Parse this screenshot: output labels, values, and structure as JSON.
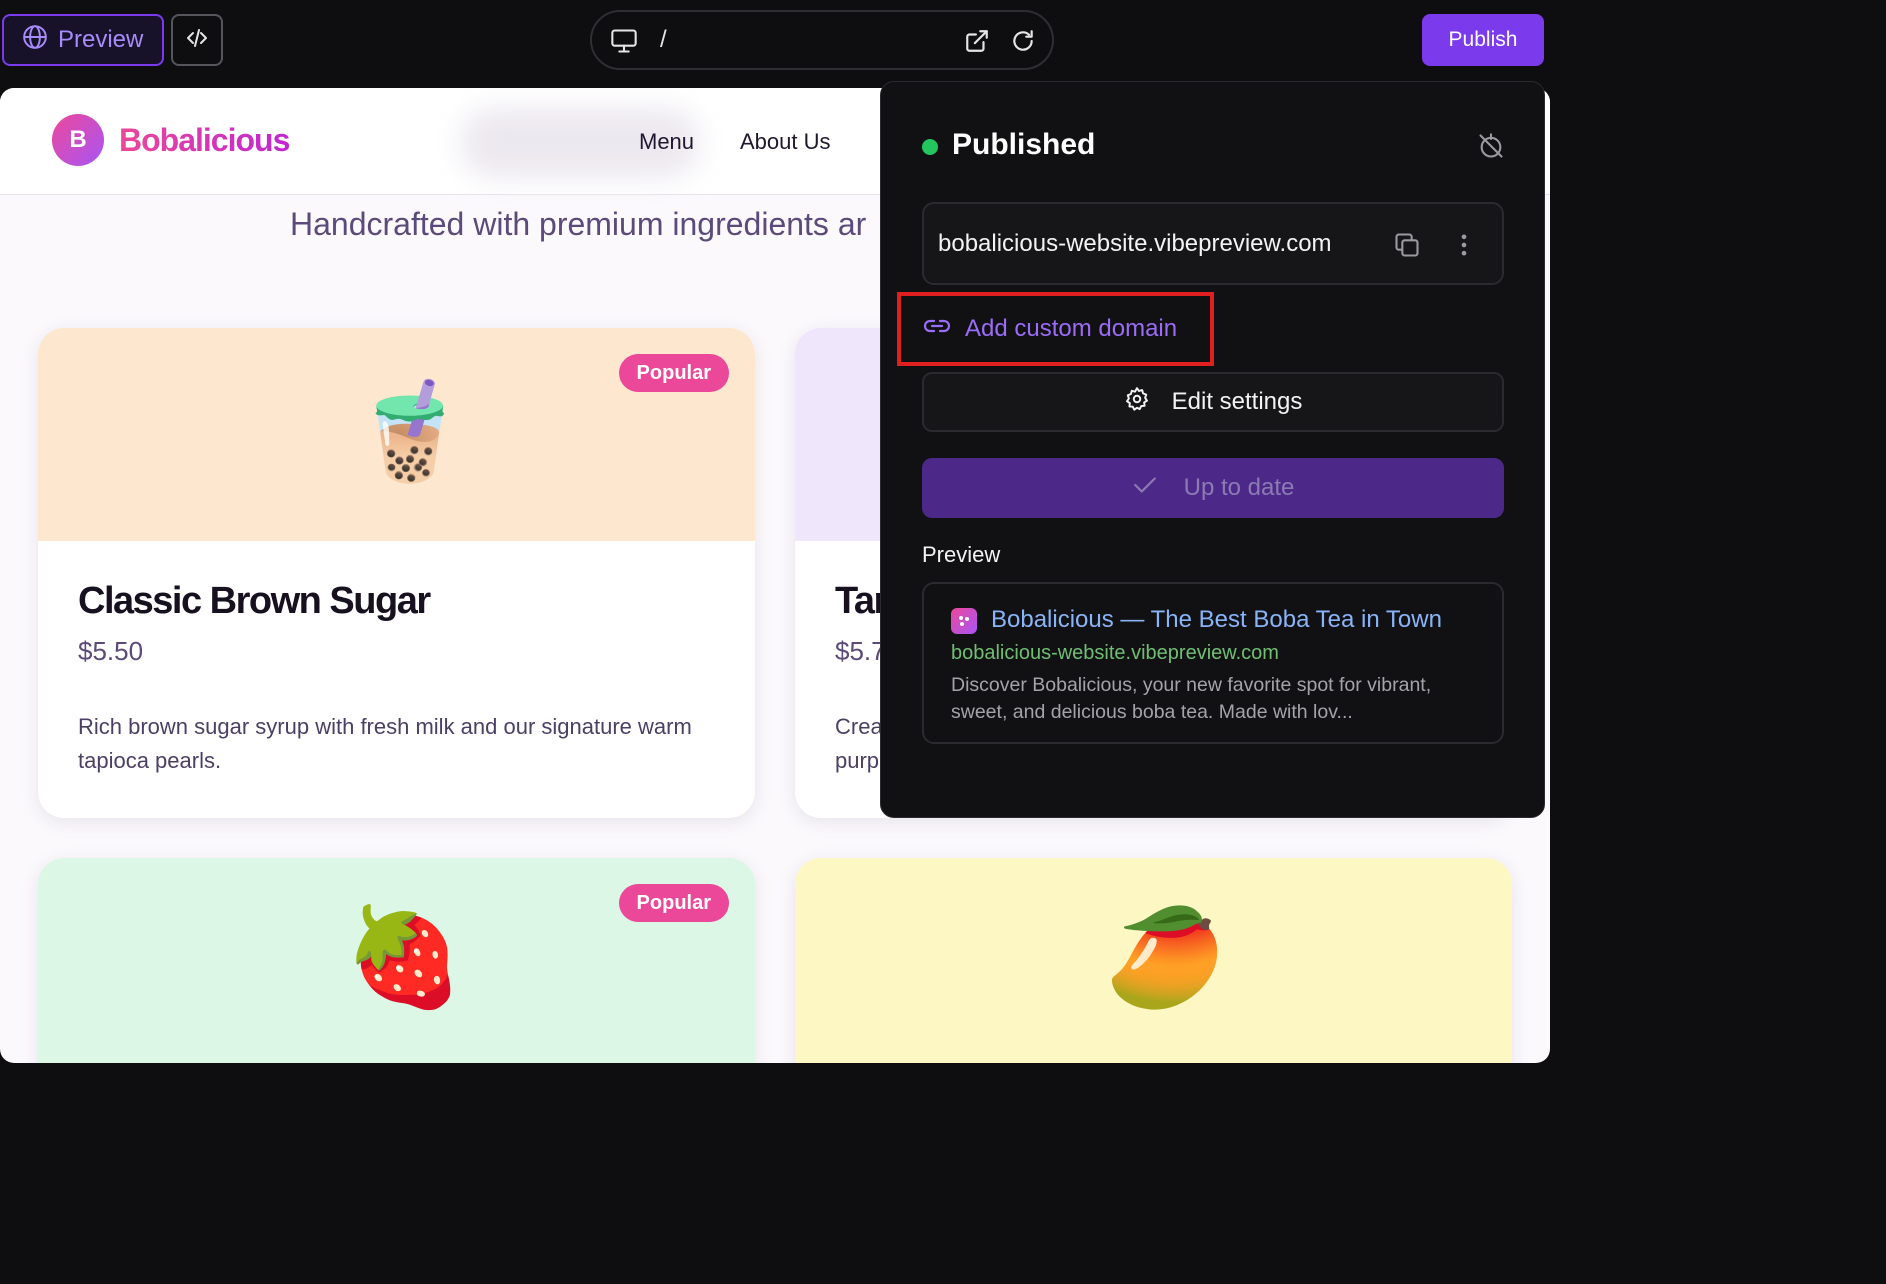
{
  "toolbar": {
    "preview_label": "Preview",
    "path": "/",
    "publish_label": "Publish"
  },
  "site": {
    "logo_letter": "B",
    "brand": "Bobalicious",
    "nav": [
      "Menu",
      "About Us"
    ],
    "tagline": "Handcrafted with premium ingredients ar",
    "cards": [
      {
        "title": "Classic Brown Sugar",
        "price": "$5.50",
        "description": "Rich brown sugar syrup with fresh milk and our signature warm tapioca pearls.",
        "badge": "Popular",
        "emoji": "🧋",
        "bg": "#fde8cf"
      },
      {
        "title": "Tar",
        "price": "$5.7",
        "description": "Crea purp",
        "badge": "",
        "emoji": "",
        "bg": "#efe6fb"
      },
      {
        "title": "",
        "price": "",
        "description": "",
        "badge": "Popular",
        "emoji": "🍓",
        "bg": "#dcf7e6"
      },
      {
        "title": "",
        "price": "",
        "description": "",
        "badge": "",
        "emoji": "🥭",
        "bg": "#fdf7c3"
      }
    ]
  },
  "popover": {
    "status": "Published",
    "status_color": "#22c55e",
    "domain": "bobalicious-website.vibepreview.com",
    "add_custom_domain": "Add custom domain",
    "edit_settings": "Edit settings",
    "up_to_date": "Up to date",
    "preview_heading": "Preview",
    "preview": {
      "title": "Bobalicious — The Best Boba Tea in Town",
      "url": "bobalicious-website.vibepreview.com",
      "description": "Discover Bobalicious, your new favorite spot for vibrant, sweet, and delicious boba tea. Made with lov..."
    }
  },
  "colors": {
    "accent": "#7c3aed",
    "brand_pink": "#ec4899",
    "highlight_box": "#e02020"
  },
  "icons": [
    "globe-icon",
    "code-icon",
    "monitor-icon",
    "external-link-icon",
    "reload-icon",
    "unpublish-icon",
    "copy-icon",
    "more-vertical-icon",
    "link-icon",
    "gear-icon",
    "check-icon",
    "favicon-icon"
  ]
}
